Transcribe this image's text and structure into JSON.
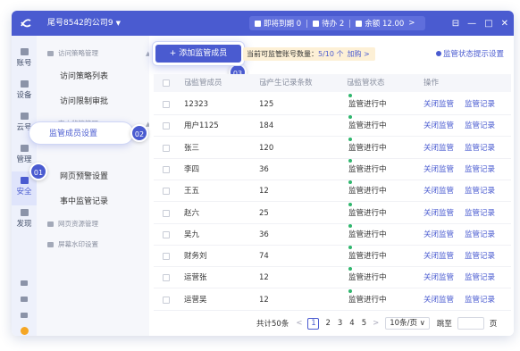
{
  "topbar": {
    "account": "尾号8542的公司9",
    "chips": [
      "即将到期 0",
      "待办 2",
      "余额 12.00"
    ],
    "chip_arrow": ">",
    "win_controls": [
      "⊟",
      "—",
      "□",
      "✕"
    ]
  },
  "rail": {
    "items": [
      {
        "label": "账号",
        "icon": "account-icon"
      },
      {
        "label": "设备",
        "icon": "device-icon"
      },
      {
        "label": "云号",
        "icon": "cloud-icon"
      },
      {
        "label": "管理",
        "icon": "manage-icon"
      },
      {
        "label": "安全",
        "icon": "security-icon"
      },
      {
        "label": "发现",
        "icon": "discover-icon"
      }
    ],
    "active_index": 4
  },
  "submenu": {
    "groups": [
      {
        "title": "访问策略管理",
        "items": [
          "访问策略列表",
          "访问限制审批"
        ]
      },
      {
        "title": "事中监管管理",
        "items": [
          "监管成员设置",
          "网页预警设置",
          "事中监管记录"
        ]
      },
      {
        "title": "网页资源管理",
        "items": []
      },
      {
        "title": "屏幕水印设置",
        "items": []
      }
    ],
    "active_item": "监管成员设置"
  },
  "callouts": [
    "01",
    "02",
    "03"
  ],
  "toolbar": {
    "add_button": "+ 添加监管成员",
    "quota_label": "当前可监管账号数量：",
    "quota_value": "5/10 个",
    "quota_link": "加购 >",
    "tips_link": "监管状态提示设置"
  },
  "table": {
    "headers": [
      "已监管成员",
      "已产生记录条数",
      "已监管状态",
      "操作"
    ],
    "rows": [
      {
        "member": "12323",
        "records": "125",
        "status": "监管进行中",
        "op1": "关闭监管",
        "op2": "监管记录"
      },
      {
        "member": "用户1125",
        "records": "184",
        "status": "监管进行中",
        "op1": "关闭监管",
        "op2": "监管记录"
      },
      {
        "member": "张三",
        "records": "120",
        "status": "监管进行中",
        "op1": "关闭监管",
        "op2": "监管记录"
      },
      {
        "member": "李四",
        "records": "36",
        "status": "监管进行中",
        "op1": "关闭监管",
        "op2": "监管记录"
      },
      {
        "member": "王五",
        "records": "12",
        "status": "监管进行中",
        "op1": "关闭监管",
        "op2": "监管记录"
      },
      {
        "member": "赵六",
        "records": "25",
        "status": "监管进行中",
        "op1": "关闭监管",
        "op2": "监管记录"
      },
      {
        "member": "吴九",
        "records": "36",
        "status": "监管进行中",
        "op1": "关闭监管",
        "op2": "监管记录"
      },
      {
        "member": "财务刘",
        "records": "74",
        "status": "监管进行中",
        "op1": "关闭监管",
        "op2": "监管记录"
      },
      {
        "member": "运营张",
        "records": "12",
        "status": "监管进行中",
        "op1": "关闭监管",
        "op2": "监管记录"
      },
      {
        "member": "运营吴",
        "records": "12",
        "status": "监管进行中",
        "op1": "关闭监管",
        "op2": "监管记录"
      }
    ]
  },
  "pagination": {
    "total": "共计50条",
    "prev": "<",
    "pages": [
      "1",
      "2",
      "3",
      "4",
      "5"
    ],
    "current": "1",
    "next": ">",
    "page_size": "10条/页 ∨",
    "jump_label": "跳至",
    "page_unit": "页"
  },
  "colors": {
    "brand": "#4a5bd0",
    "status_green": "#2fb66d",
    "quota_bg": "#fdf0d6"
  }
}
